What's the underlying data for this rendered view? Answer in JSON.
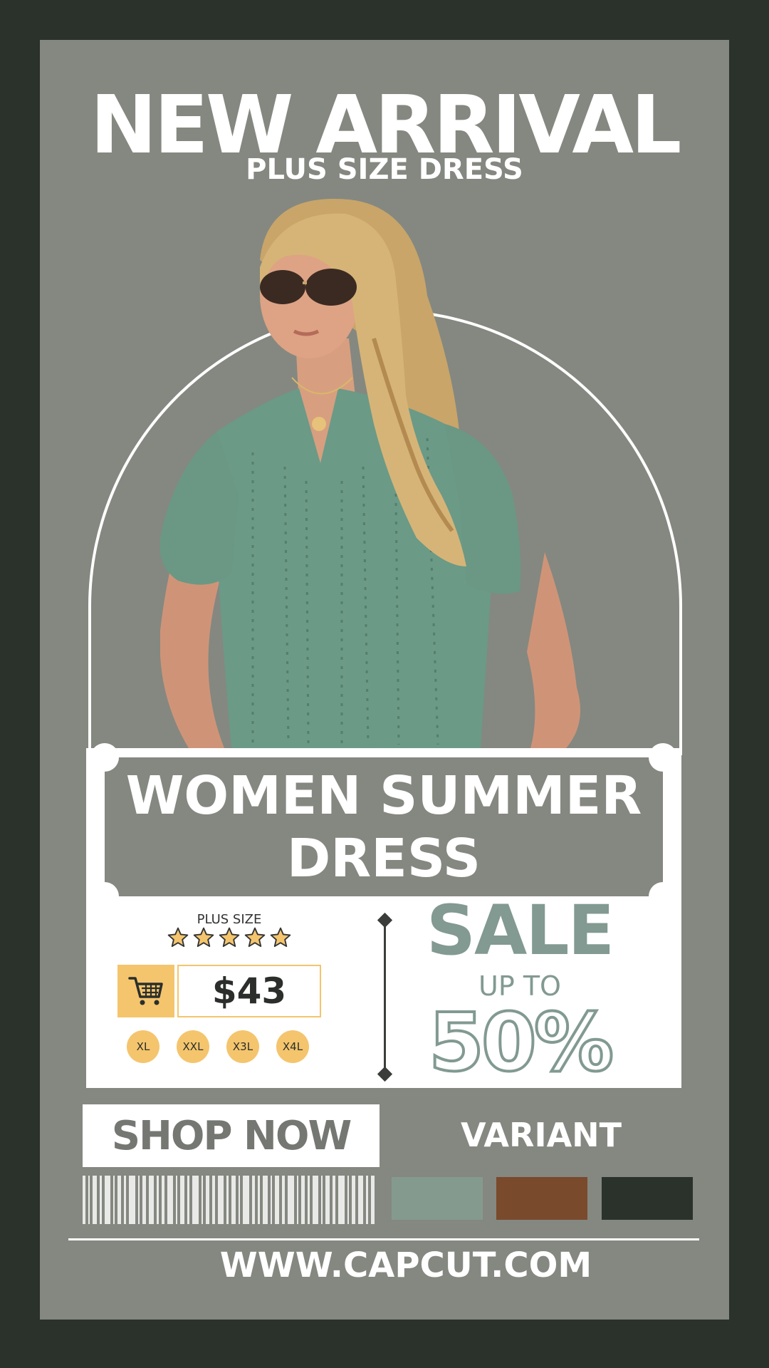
{
  "header": {
    "title": "NEW ARRIVAL",
    "subtitle": "PLUS SIZE DRESS"
  },
  "product": {
    "title_line1": "WOMEN SUMMER",
    "title_line2": "DRESS",
    "size_label": "PLUS SIZE",
    "rating": 5,
    "rating_max": 5,
    "price": "$43",
    "sizes": [
      "XL",
      "XXL",
      "X3L",
      "X4L"
    ]
  },
  "promo": {
    "sale": "SALE",
    "up_to": "UP TO",
    "discount": "50%"
  },
  "actions": {
    "shop_now": "SHOP NOW"
  },
  "variants": {
    "label": "VARIANT",
    "colors": [
      "#859a8e",
      "#7a4a2c",
      "#2b312b"
    ]
  },
  "footer": {
    "url": "WWW.CAPCUT.COM"
  },
  "colors": {
    "background": "#2b312b",
    "panel": "#848880",
    "accent_yellow": "#f4c56d",
    "sage": "#829a91",
    "shirt": "#6b9a87"
  },
  "icons": {
    "cart": "shopping-cart-icon",
    "star": "star-icon"
  }
}
